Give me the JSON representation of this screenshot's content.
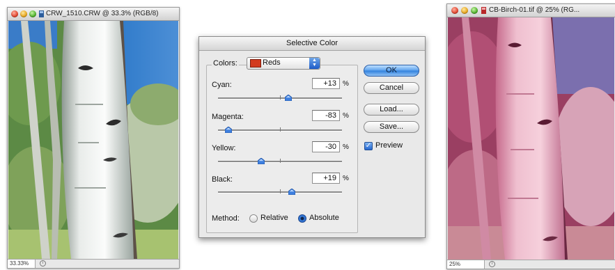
{
  "left_window": {
    "title": "CRW_1510.CRW @ 33.3% (RGB/8)",
    "zoom": "33.33%"
  },
  "right_window": {
    "title": "CB-Birch-01.tif @ 25% (RG...",
    "zoom": "25%"
  },
  "dialog": {
    "title": "Selective Color",
    "colors_label": "Colors:",
    "colors_value": "Reds",
    "colors_swatch": "#d23a1e",
    "sliders": [
      {
        "label": "Cyan:",
        "value": "+13",
        "pct": "%",
        "amount": 13
      },
      {
        "label": "Magenta:",
        "value": "-83",
        "pct": "%",
        "amount": -83
      },
      {
        "label": "Yellow:",
        "value": "-30",
        "pct": "%",
        "amount": -30
      },
      {
        "label": "Black:",
        "value": "+19",
        "pct": "%",
        "amount": 19
      }
    ],
    "buttons": {
      "ok": "OK",
      "cancel": "Cancel",
      "load": "Load...",
      "save": "Save..."
    },
    "preview_label": "Preview",
    "preview_checked": true,
    "method_label": "Method:",
    "method_options": [
      "Relative",
      "Absolute"
    ],
    "method_selected": "Absolute"
  },
  "colors": {
    "accent_blue": "#2f7fdc",
    "reds_swatch": "#d23a1e"
  }
}
